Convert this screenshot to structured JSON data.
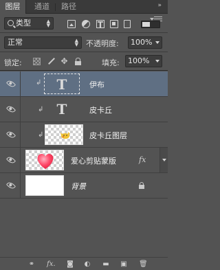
{
  "tabs": [
    {
      "label": "图层",
      "active": true
    },
    {
      "label": "通道",
      "active": false
    },
    {
      "label": "路径",
      "active": false
    }
  ],
  "filter": {
    "kind_label": "类型"
  },
  "blend": {
    "mode": "正常",
    "opacity_label": "不透明度:",
    "opacity_value": "100%",
    "lock_label": "锁定:",
    "fill_label": "填充:",
    "fill_value": "100%"
  },
  "layers": [
    {
      "name": "伊布",
      "type": "text",
      "clipped": true,
      "selected": true,
      "thumb": "T"
    },
    {
      "name": "皮卡丘",
      "type": "text",
      "clipped": true,
      "selected": false,
      "thumb": "T"
    },
    {
      "name": "皮卡丘图层",
      "type": "image",
      "clipped": true,
      "selected": false
    },
    {
      "name": "爱心剪贴蒙版",
      "type": "image",
      "clipped": false,
      "selected": false,
      "effects": "fx"
    },
    {
      "name": "背景",
      "type": "background",
      "clipped": false,
      "selected": false,
      "locked": true
    }
  ],
  "colors": {
    "panel_bg": "#535353",
    "tabbar_bg": "#3a3a3a",
    "selected_row": "#5f6f83",
    "heart": "#ff3b5c"
  },
  "icons": {
    "filter_types": [
      "pixel-filter-icon",
      "adjustment-filter-icon",
      "type-filter-icon",
      "shape-filter-icon",
      "smart-object-filter-icon"
    ],
    "locks": [
      "lock-transparent-pixels-icon",
      "lock-image-pixels-icon",
      "lock-position-icon",
      "lock-all-icon"
    ],
    "bottom": [
      "link-layers-icon",
      "fx-icon",
      "add-mask-icon",
      "new-adjustment-icon",
      "new-group-icon",
      "new-layer-icon",
      "delete-layer-icon"
    ]
  }
}
